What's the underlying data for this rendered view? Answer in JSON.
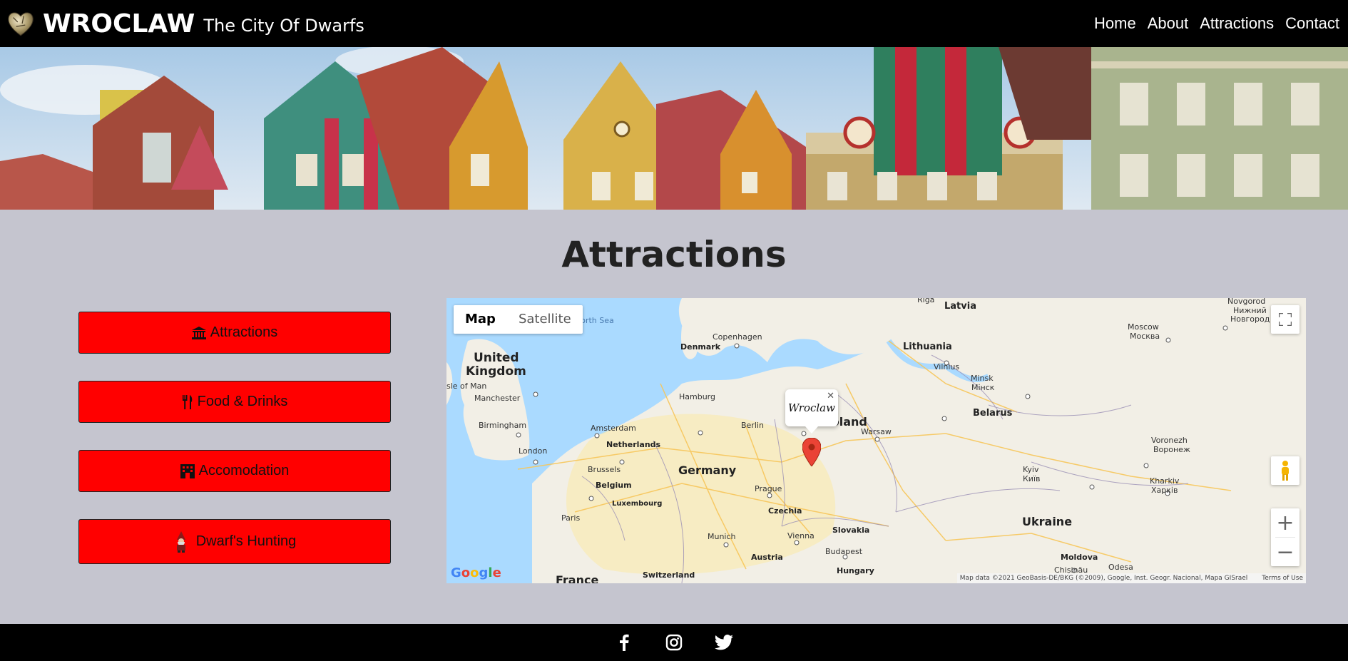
{
  "nav": {
    "brand_name": "WROCLAW",
    "brand_tagline": "The City Of Dwarfs",
    "links": [
      "Home",
      "About",
      "Attractions",
      "Contact"
    ]
  },
  "main": {
    "title": "Attractions",
    "buttons": [
      {
        "label": "Attractions",
        "icon": "landmark-icon"
      },
      {
        "label": "Food & Drinks",
        "icon": "utensils-icon"
      },
      {
        "label": "Accomodation",
        "icon": "hotel-icon"
      },
      {
        "label": "Dwarf's Hunting",
        "icon": "dwarf-icon"
      }
    ]
  },
  "map": {
    "type_options": [
      "Map",
      "Satellite"
    ],
    "selected_type": "Map",
    "info_window_text": "Wroclaw",
    "zoom_in": "+",
    "zoom_out": "−",
    "google_logo": "Google",
    "attribution": "Map data ©2021 GeoBasis-DE/BKG (©2009), Google, Inst. Geogr. Nacional, Mapa GISrael",
    "terms": "Terms of Use",
    "labels": {
      "riga": "Riga",
      "latvia": "Latvia",
      "novgorod": "Novgorod",
      "nizhny": "Нижний",
      "novgorod_ru": "Новгород",
      "north_sea": "North Sea",
      "moscow": "Moscow",
      "moskva": "Москва",
      "copenhagen": "Copenhagen",
      "denmark": "Denmark",
      "lithuania": "Lithuania",
      "vilnius": "Vilnius",
      "united": "United",
      "kingdom": "Kingdom",
      "isle_of_man": "sle of Man",
      "minsk": "Minsk",
      "minsk_ru": "Мінск",
      "manchester": "Manchester",
      "hamburg": "Hamburg",
      "belarus": "Belarus",
      "birmingham": "Birmingham",
      "amsterdam": "Amsterdam",
      "berlin": "Berlin",
      "poland": "Poland",
      "warsaw": "Warsaw",
      "netherlands": "Netherlands",
      "london": "London",
      "voronezh": "Voronezh",
      "voronezh_ru": "Воронеж",
      "brussels": "Brussels",
      "germany": "Germany",
      "kyiv": "Kyiv",
      "kyiv_ua": "Київ",
      "belgium": "Belgium",
      "prague": "Prague",
      "kharkiv": "Kharkiv",
      "kharkiv_ua": "Харків",
      "luxembourg": "Luxembourg",
      "paris": "Paris",
      "czechia": "Czechia",
      "slovakia": "Slovakia",
      "ukraine": "Ukraine",
      "vienna": "Vienna",
      "munich": "Munich",
      "budapest": "Budapest",
      "austria": "Austria",
      "moldova": "Moldova",
      "hungary": "Hungary",
      "odesa": "Odesa",
      "chisinau": "Chișinău",
      "switzerland": "Switzerland",
      "france": "France"
    }
  },
  "colors": {
    "nav_bg": "#000000",
    "page_bg": "#c5c5cf",
    "button_bg": "#ff0000",
    "footer_bg": "#000000"
  },
  "footer": {
    "social": [
      "facebook-icon",
      "instagram-icon",
      "twitter-icon"
    ]
  }
}
